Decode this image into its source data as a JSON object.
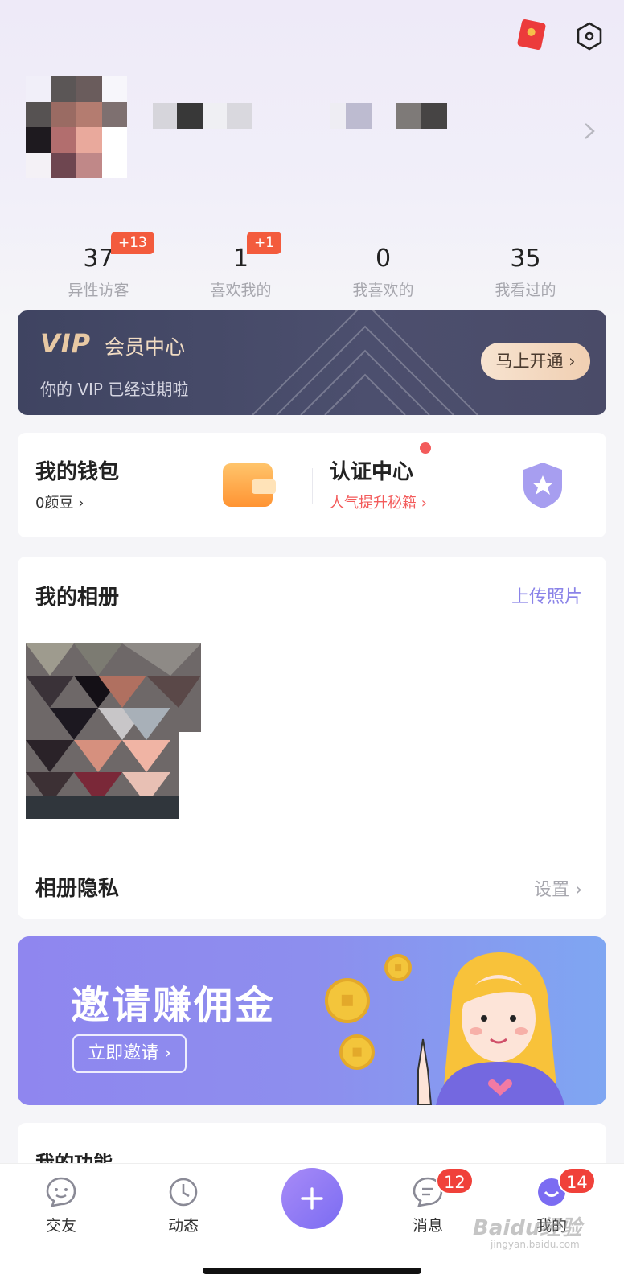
{
  "stats": [
    {
      "value": "37",
      "label": "异性访客",
      "badge": "+13"
    },
    {
      "value": "1",
      "label": "喜欢我的",
      "badge": "+1"
    },
    {
      "value": "0",
      "label": "我喜欢的",
      "badge": ""
    },
    {
      "value": "35",
      "label": "我看过的",
      "badge": ""
    }
  ],
  "vip": {
    "logo": "VIP",
    "title": "会员中心",
    "subtitle": "你的 VIP 已经过期啦",
    "button": "马上开通"
  },
  "wallet": {
    "title": "我的钱包",
    "sub": "0颜豆",
    "cert_title": "认证中心",
    "cert_sub": "人气提升秘籍"
  },
  "album": {
    "title": "我的相册",
    "upload": "上传照片",
    "privacy_label": "相册隐私",
    "privacy_action": "设置"
  },
  "invite": {
    "title": "邀请赚佣金",
    "button": "立即邀请"
  },
  "functions": {
    "title": "我的功能"
  },
  "tabbar": {
    "items": [
      {
        "label": "交友",
        "icon": "chat-face-icon",
        "badge": ""
      },
      {
        "label": "动态",
        "icon": "clock-icon",
        "badge": ""
      },
      {
        "label": "",
        "icon": "plus-icon",
        "badge": ""
      },
      {
        "label": "消息",
        "icon": "message-icon",
        "badge": "12"
      },
      {
        "label": "我的",
        "icon": "profile-icon",
        "badge": "14"
      }
    ]
  },
  "watermark": {
    "text": "Baidu经验",
    "sub": "jingyan.baidu.com"
  },
  "colors": {
    "accent": "#7b6cf2",
    "badge_red": "#f35b3d",
    "vip_bg": "#3f4461",
    "link_purple": "#8a83e8",
    "cert_red": "#f35b5b"
  }
}
